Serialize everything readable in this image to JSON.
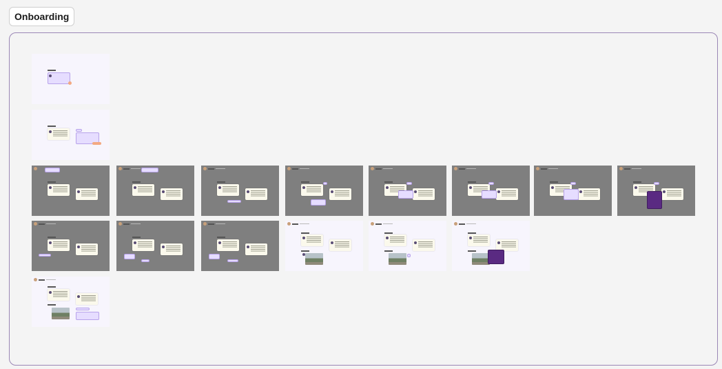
{
  "section": {
    "title": "Onboarding",
    "border_color": "#9a86b5"
  },
  "frames_background": {
    "light": "#f7f5fd",
    "dark": "#7f7f7f"
  }
}
